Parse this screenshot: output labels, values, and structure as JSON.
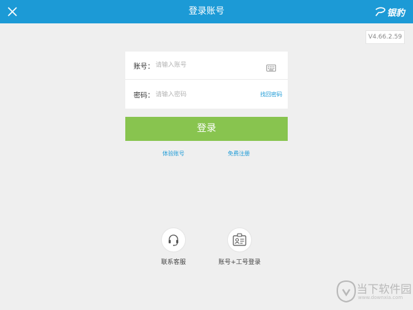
{
  "header": {
    "title": "登录账号",
    "logo_text": "银豹",
    "close_icon": "close-icon",
    "background": "#1c9ad6"
  },
  "version": "V4.66.2.59",
  "form": {
    "account": {
      "label": "账号：",
      "placeholder": "请输入账号",
      "value": "",
      "icon": "keyboard-icon"
    },
    "password": {
      "label": "密码：",
      "placeholder": "请输入密码",
      "value": "",
      "forgot_label": "找回密码"
    }
  },
  "login_button": {
    "label": "登录",
    "color": "#88c44f"
  },
  "links": {
    "trial": "体验账号",
    "register": "免费注册"
  },
  "bottom_actions": [
    {
      "label": "联系客服",
      "icon": "headset-icon"
    },
    {
      "label": "账号+工号登录",
      "icon": "id-card-icon"
    }
  ],
  "watermark": {
    "text": "当下软件园",
    "url": "www.downxia.com"
  }
}
